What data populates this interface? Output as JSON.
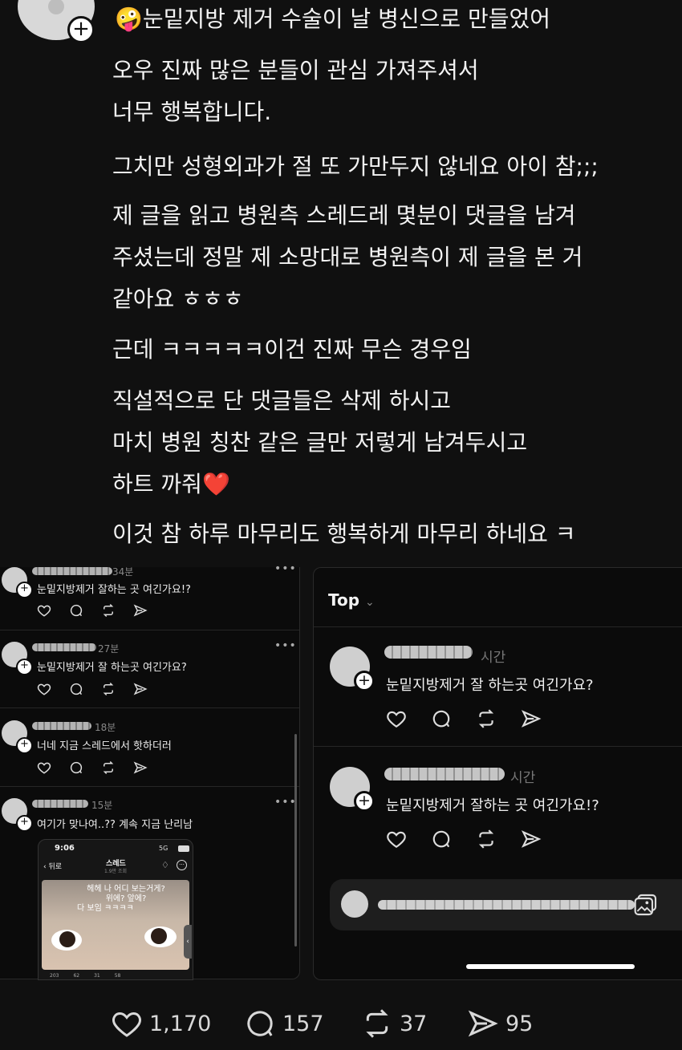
{
  "post": {
    "title_emoji": "🤪",
    "title": "눈밑지방 제거 수술이 날 병신으로 만들었어",
    "paragraphs": [
      [
        "오우 진짜 많은 분들이 관심 가져주셔서",
        "너무 행복합니다."
      ],
      [
        "그치만 성형외과가 절 또 가만두지 않네요 아이 참;;;"
      ],
      [
        "제 글을 읽고 병원측 스레드레 몇분이 댓글을 남겨",
        "주셨는데 정말 제 소망대로 병원측이 제 글을 본 거",
        "같아요 ㅎㅎㅎ"
      ],
      [
        "근데 ㅋㅋㅋㅋㅋ이건 진짜 무슨 경우임"
      ],
      [
        "직설적으로 단 댓글들은 삭제 하시고",
        "마치 병원 칭찬 같은 글만 저렇게 남겨두시고",
        "하트 까줘❤️"
      ],
      [
        "이것 참 하루 마무리도 행복하게 마무리 하네요 ㅋ"
      ]
    ]
  },
  "left_shot": {
    "comments": [
      {
        "time": "34분",
        "text": "눈밑지방제거 잘하는 곳 여긴가요!?"
      },
      {
        "time": "27분",
        "text": "눈밑지방제거 잘 하는곳 여긴가요?"
      },
      {
        "time": "18분",
        "text": "너네 지금 스레드에서 핫하더러"
      },
      {
        "time": "15분",
        "text": "여기가 맞나여..?? 계속 지금 난리남"
      }
    ],
    "embed": {
      "clock": "9:06",
      "signal": "5G",
      "back": "뒤로",
      "header_title": "스레드",
      "header_sub": "1.9만 조회",
      "overlay_lines": [
        "헤헤 나 어디 보는거게?",
        "위에? 앞에?",
        "다 보임 ㅋㅋㅋㅋ"
      ],
      "footer_counts": [
        "203",
        "62",
        "31",
        "58"
      ]
    }
  },
  "right_shot": {
    "sort_label": "Top",
    "comments": [
      {
        "time": "시간",
        "text": "눈밑지방제거 잘 하는곳 여긴가요?"
      },
      {
        "time": "시간",
        "text": "눈밑지방제거 잘하는 곳 여긴가요!?"
      }
    ]
  },
  "metrics": {
    "likes": "1,170",
    "replies": "157",
    "reposts": "37",
    "shares": "95"
  },
  "colors": {
    "background": "#101010",
    "heart": "#e0312f"
  }
}
